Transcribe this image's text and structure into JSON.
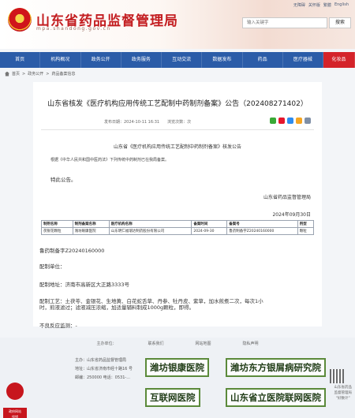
{
  "header": {
    "title": "山东省药品监督管理局",
    "subtitle": "mpa.shandong.gov.cn",
    "top_links": [
      "无障碍",
      "关怀版",
      "繁體",
      "English"
    ],
    "search": {
      "placeholder": "输入关键字",
      "button": "搜索"
    }
  },
  "nav": {
    "items": [
      "首页",
      "机构概况",
      "政务公开",
      "政务服务",
      "互动交流",
      "数据发布",
      "药品",
      "医疗器械",
      "化妆品"
    ]
  },
  "breadcrumb": [
    "首页",
    "政务公开",
    "药品备案信息"
  ],
  "article": {
    "title": "山东省核发《医疗机构应用传统工艺配制中药制剂备案》公告（202408271402）",
    "date": "发布日期：2024-10-11 16:31",
    "views": "浏览次数：次",
    "notice_heading": "山东省《医疗机构应用传统工艺配制中药制剂备案》核发公告",
    "basis": "根据《中华人民共和国中医药法》下列传统中药制剂已在我局备案。",
    "announce": "特此公告。",
    "signer": "山东省药品监督管理局",
    "sign_date": "2024年09月30日",
    "table": {
      "headers": [
        "制剂名称",
        "制剂备案名称",
        "医疗机构名称",
        "备案时间",
        "备案号",
        "剂型"
      ],
      "rows": [
        [
          "茯银花颗粒",
          "潍坊眼康医院",
          "山东明仁福瑞达制药股份有限公司",
          "2024-09-30",
          "鲁药制备字Z20240160000",
          "颗粒"
        ]
      ]
    },
    "reg_no": "鲁药制备字Z20240160000",
    "unit": "配制单位：",
    "address": "配制地址：济南市高新区大正路3333号",
    "process_1": "配制工艺：土茯苓、金银花、生地黄、白花蛇舌草、丹参、牡丹皮、紫草，加水煎煮二次，每次1小",
    "process_2": "时，煎液滤过；滤液减压浓缩，加适量辅料制成1000g颗粒，即得。",
    "adverse": "不良反应监测：-"
  },
  "footer": {
    "links": [
      "主办单位：",
      "联系我们",
      "网站地图",
      "隐私声明"
    ],
    "info": [
      "主办：山东省药品监督管理局",
      "地址：山东省济南市经十路16 号",
      "邮编：250000    电话：0531-..."
    ],
    "badge_label": "政府网站\n找错",
    "right_text": "山东省药品\n监督管理局\n“好数计”"
  },
  "watermark": {
    "lines": [
      "潍坊银康医院",
      "潍坊东方银屑病研究院",
      "互联网医院",
      "山东省立医院联网医院"
    ]
  },
  "colors": {
    "brand_red": "#c31d20",
    "nav_blue": "#2b5ca8",
    "special_red": "#d4232a"
  }
}
